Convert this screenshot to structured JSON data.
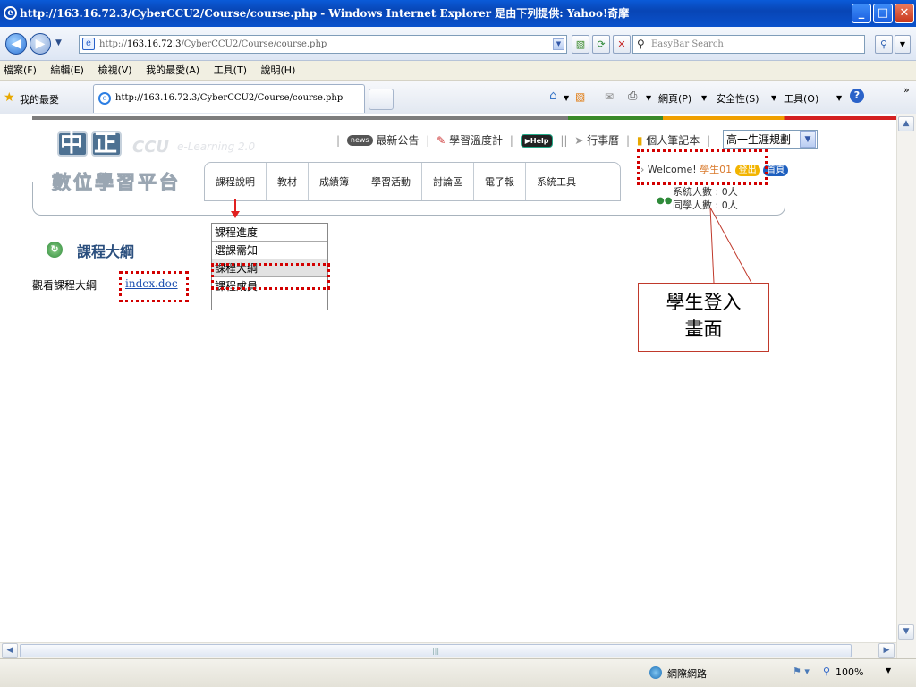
{
  "window": {
    "title": "http://163.16.72.3/CyberCCU2/Course/course.php - Windows Internet Explorer 是由下列提供: Yahoo!奇摩"
  },
  "address": {
    "prefix": "http://",
    "host": "163.16.72.3",
    "path": "/CyberCCU2/Course/course.php"
  },
  "search": {
    "placeholder": "EasyBar Search"
  },
  "menubar": {
    "items": [
      "檔案(F)",
      "編輯(E)",
      "檢視(V)",
      "我的最愛(A)",
      "工具(T)",
      "說明(H)"
    ]
  },
  "favbar": {
    "favorites": "我的最愛",
    "tab_title": "http://163.16.72.3/CyberCCU2/Course/course.php",
    "page_menu": "網頁(P)",
    "safety_menu": "安全性(S)",
    "tools_menu": "工具(O)"
  },
  "site": {
    "logo_top": "中正",
    "logo_ccu": "CCU",
    "logo_elearning": "e-Learning 2.0",
    "logo_bottom": "數位學習平台"
  },
  "toplinks": {
    "news_badge": "news",
    "news": "最新公告",
    "thermo": "學習溫度計",
    "help": "Help",
    "calendar": "行事曆",
    "notebook": "個人筆記本",
    "course_select": "高一生涯規劃"
  },
  "nav": {
    "tabs": [
      "課程說明",
      "教材",
      "成績簿",
      "學習活動",
      "討論區",
      "電子報",
      "系統工具"
    ]
  },
  "welcome": {
    "text": "Welcome!",
    "user": "學生01",
    "logout": "登出",
    "home": "首頁"
  },
  "stats": {
    "system_users": "系統人數 : 0人",
    "classmates": "同學人數 : 0人"
  },
  "dropdown": {
    "items": [
      "課程進度",
      "選課需知",
      "課程大綱",
      "課程成員"
    ]
  },
  "section": {
    "title": "課程大綱",
    "view_label": "觀看課程大綱",
    "doc_link": "index.doc"
  },
  "callout": {
    "line1": "學生登入",
    "line2": "畫面"
  },
  "status": {
    "zone": "網際網路",
    "zoom": "100%"
  },
  "colors": {
    "highlight": "#d20000",
    "accent_blue": "#0a52cc",
    "section_title": "#2b4f7e"
  }
}
